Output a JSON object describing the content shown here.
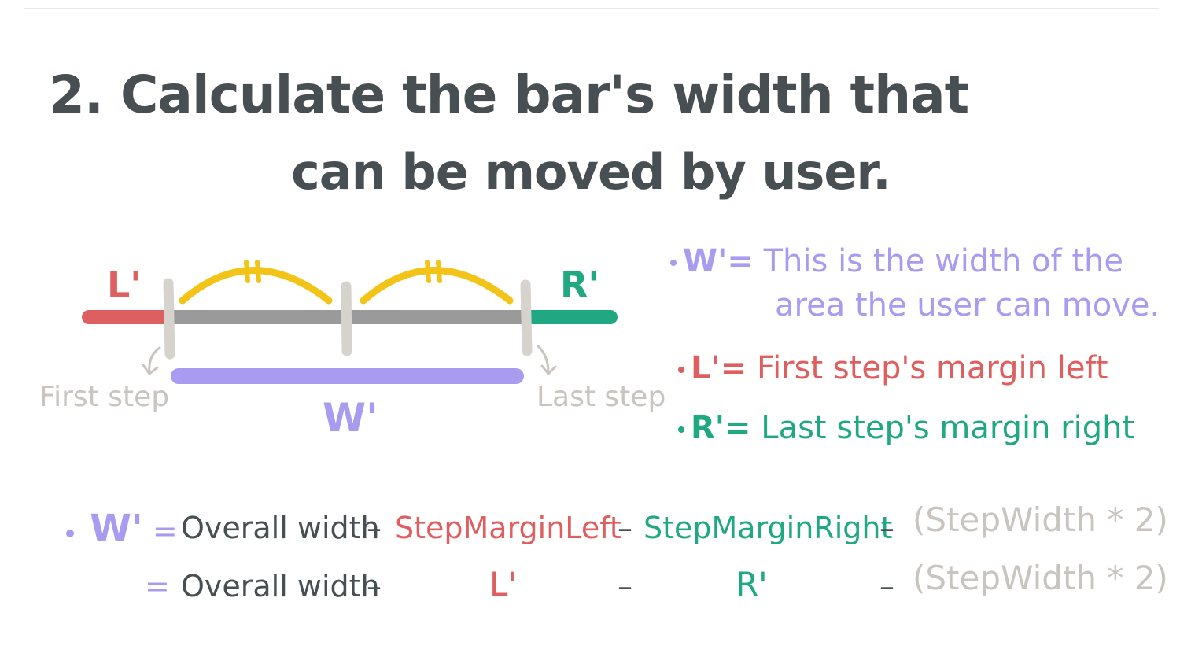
{
  "title": {
    "line1": "2. Calculate the bar's width that",
    "line2": "can be moved by user."
  },
  "diagram": {
    "label_l": "L'",
    "label_r": "R'",
    "label_w": "W'",
    "first_step": "First step",
    "last_step": "Last step",
    "colors": {
      "red": "#de5f5f",
      "green": "#1fa882",
      "gray": "#9a9a9a",
      "purple": "#a99cf0",
      "yellow": "#f2c418",
      "step": "#d6d2cc"
    }
  },
  "legend": [
    {
      "symbol": "W'=",
      "text": "This is the width of the",
      "text2": "area the user can move.",
      "color": "#a99cf0"
    },
    {
      "symbol": "L'=",
      "text": "First step's margin left",
      "color": "#de5f5f"
    },
    {
      "symbol": "R'=",
      "text": "Last step's margin right",
      "color": "#1fa882"
    }
  ],
  "formula": {
    "lhs": "W'",
    "eq": "=",
    "overall": "Overall width",
    "minus": "–",
    "margin_left": "StepMarginLeft",
    "margin_right": "StepMarginRight",
    "step_width": "(StepWidth * 2)",
    "l": "L'",
    "r": "R'"
  }
}
